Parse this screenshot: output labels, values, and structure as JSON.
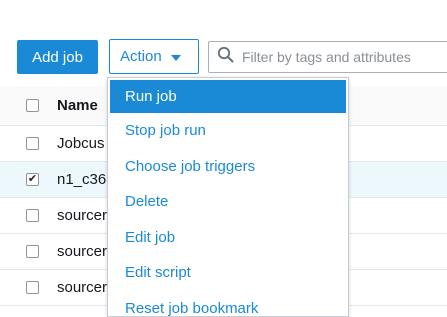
{
  "toolbar": {
    "add_job_label": "Add job",
    "action_label": "Action",
    "search_placeholder": "Filter by tags and attributes"
  },
  "table": {
    "header": {
      "name": "Name"
    },
    "rows": [
      {
        "name": "Jobcus",
        "checked": false
      },
      {
        "name": "n1_c36",
        "checked": true
      },
      {
        "name": "sourcer",
        "checked": false
      },
      {
        "name": "sourcer",
        "checked": false
      },
      {
        "name": "sourcer",
        "checked": false
      }
    ]
  },
  "action_menu": {
    "items": [
      "Run job",
      "Stop job run",
      "Choose job triggers",
      "Delete",
      "Edit job",
      "Edit script",
      "Reset job bookmark"
    ],
    "highlighted_index": 0
  },
  "colors": {
    "accent": "#1a8ad6",
    "selected_row": "#edf8fd"
  },
  "icons": {
    "search": "search-icon",
    "caret": "caret-down-icon",
    "check": "checkmark-icon"
  }
}
